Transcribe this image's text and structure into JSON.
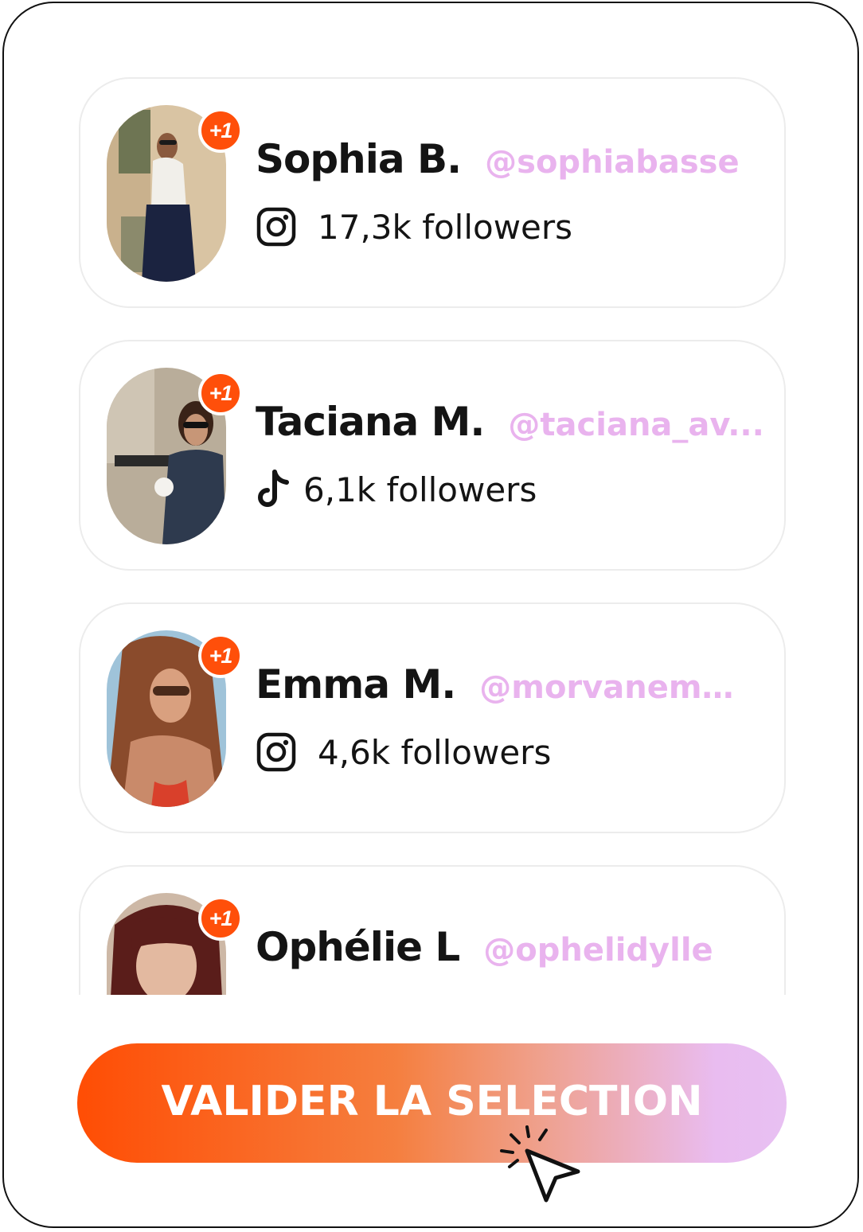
{
  "influencers": [
    {
      "name": "Sophia B.",
      "handle": "@sophiabasse",
      "platform": "instagram-icon",
      "followers": "17,3k followers",
      "badge": "+1"
    },
    {
      "name": "Taciana M.",
      "handle": "@taciana_av...",
      "platform": "tiktok-icon",
      "followers": "6,1k followers",
      "badge": "+1"
    },
    {
      "name": "Emma M.",
      "handle": "@morvanemma",
      "platform": "instagram-icon",
      "followers": "4,6k followers",
      "badge": "+1"
    },
    {
      "name": "Ophélie L",
      "handle": "@ophelidylle",
      "badge": "+1"
    }
  ],
  "actions": {
    "validate_label": "VALIDER LA SELECTION"
  },
  "colors": {
    "accent": "#ff4f0a",
    "handle": "#e9b3ee",
    "text": "#141414",
    "card_border": "#ececec"
  }
}
